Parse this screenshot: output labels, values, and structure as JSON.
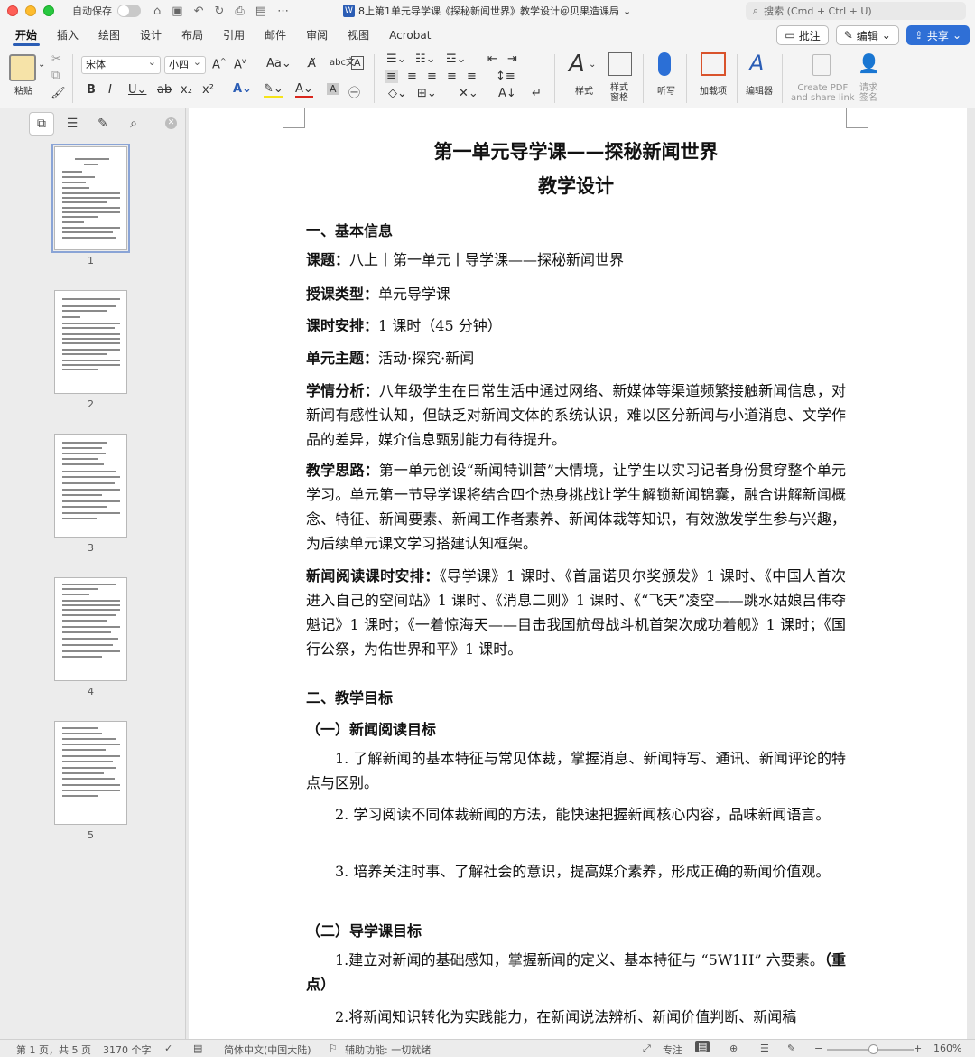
{
  "titlebar": {
    "autosave_label": "自动保存",
    "document_title": "8上第1单元导学课《探秘新闻世界》教学设计＠贝果造课局",
    "search_placeholder": "搜索 (Cmd + Ctrl + U)"
  },
  "ribbon_tabs": [
    "开始",
    "插入",
    "绘图",
    "设计",
    "布局",
    "引用",
    "邮件",
    "审阅",
    "视图",
    "Acrobat"
  ],
  "ribbon_actions": {
    "comment": "批注",
    "edit": "编辑",
    "share": "共享"
  },
  "ribbon": {
    "paste": "粘贴",
    "font_name": "宋体",
    "font_size": "小四",
    "styles": "样式",
    "styles_pane": "样式\n窗格",
    "dictate": "听写",
    "addins": "加载项",
    "editor": "编辑器",
    "create_pdf": "Create PDF\nand share link",
    "request_sign": "请求\n签名"
  },
  "sidebar": {
    "page_labels": [
      "1",
      "2",
      "3",
      "4",
      "5"
    ],
    "selected_page": 1
  },
  "document": {
    "title_line1": "第一单元导学课——探秘新闻世界",
    "title_line2": "教学设计",
    "section1": "一、基本信息",
    "course_label": "课题：",
    "course_value": "八上丨第一单元丨导学课——探秘新闻世界",
    "type_label": "授课类型：",
    "type_value": "单元导学课",
    "time_label": "课时安排：",
    "time_value": "1 课时（45 分钟）",
    "theme_label": "单元主题：",
    "theme_value": "活动·探究·新闻",
    "analysis_label": "学情分析：",
    "analysis_value": "八年级学生在日常生活中通过网络、新媒体等渠道频繁接触新闻信息，对新闻有感性认知，但缺乏对新闻文体的系统认识，难以区分新闻与小道消息、文学作品的差异，媒介信息甄别能力有待提升。",
    "idea_label": "教学思路：",
    "idea_value": "第一单元创设“新闻特训营”大情境，让学生以实习记者身份贯穿整个单元学习。单元第一节导学课将结合四个热身挑战让学生解锁新闻锦囊，融合讲解新闻概念、特征、新闻要素、新闻工作者素养、新闻体裁等知识，有效激发学生参与兴趣，为后续单元课文学习搭建认知框架。",
    "schedule_label": "新闻阅读课时安排：",
    "schedule_value": "《导学课》1 课时、《首届诺贝尔奖颁发》1 课时、《中国人首次进入自己的空间站》1 课时、《消息二则》1 课时、《“飞天”凌空——跳水姑娘吕伟夺魁记》1 课时；《一着惊海天——目击我国航母战斗机首架次成功着舰》1 课时；《国行公祭，为佑世界和平》1 课时。",
    "section2": "二、教学目标",
    "sub1": "（一）新闻阅读目标",
    "goal1": "1. 了解新闻的基本特征与常见体裁，掌握消息、新闻特写、通讯、新闻评论的特点与区别。",
    "goal2": "2. 学习阅读不同体裁新闻的方法，能快速把握新闻核心内容，品味新闻语言。",
    "goal3": "3. 培养关注时事、了解社会的意识，提高媒介素养，形成正确的新闻价值观。",
    "sub2": "（二）导学课目标",
    "goal4a": "1.建立对新闻的基础感知，掌握新闻的定义、基本特征与 “5W1H” 六要素。",
    "goal4b": "（重点）",
    "goal5": "2.将新闻知识转化为实践能力，在新闻说法辨析、新闻价值判断、新闻稿"
  },
  "statusbar": {
    "page_info": "第 1 页，共 5 页",
    "word_count": "3170 个字",
    "language": "简体中文(中国大陆)",
    "accessibility": "辅助功能: 一切就绪",
    "focus": "专注",
    "zoom": "160%"
  },
  "colors": {
    "accent": "#2b5db5",
    "share": "#2f6fd6"
  }
}
